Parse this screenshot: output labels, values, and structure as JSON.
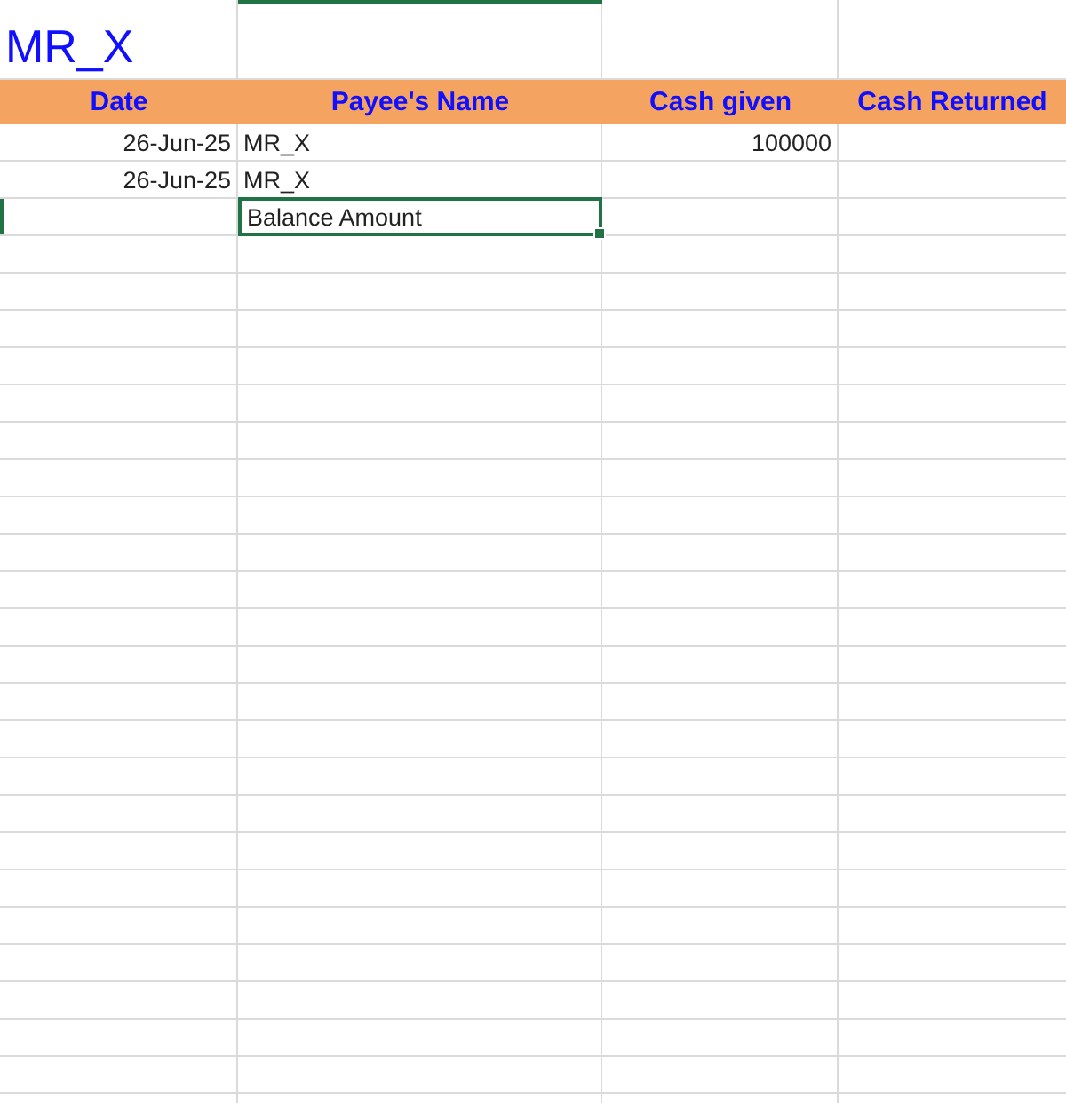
{
  "title": "MR_X",
  "columns": [
    {
      "label": "Date"
    },
    {
      "label": "Payee's Name"
    },
    {
      "label": "Cash given"
    },
    {
      "label": "Cash Returned"
    }
  ],
  "rows": [
    {
      "date": "26-Jun-25",
      "payee_name": "MR_X",
      "cash_given": "100000",
      "selected": false
    },
    {
      "date": "26-Jun-25",
      "payee_name": "MR_X",
      "selected": false
    },
    {
      "payee_name": "Balance Amount",
      "selected": true
    }
  ]
}
